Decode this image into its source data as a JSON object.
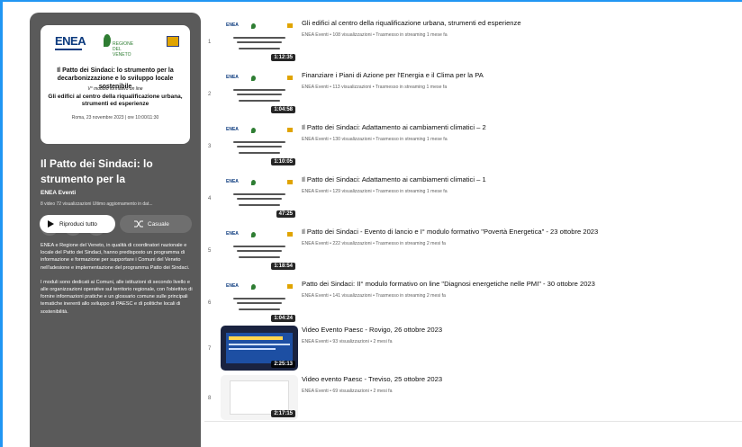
{
  "playlist": {
    "cover": {
      "logo_enea": "ENEA",
      "logo_region": "REGIONE DEL VENETO",
      "title": "Il Patto dei Sindaci: lo strumento per la decarbonizzazione e lo sviluppo locale sostenibile",
      "module": "V° modulo formativo on line",
      "subject": "Gli edifici al centro della riqualificazione urbana, strumenti ed esperienze",
      "date": "Roma, 23 novembre 2023 | ore 10:00/11:30"
    },
    "title": "Il Patto dei Sindaci: lo strumento per la decarbonizzazione e lo...",
    "channel": "ENEA Eventi",
    "meta": "8 video  72 visualizzazioni  Ultimo aggiornamento in dat...",
    "actions": {
      "save_icon": "≡+",
      "share_icon": "↗",
      "more_icon": "⋮",
      "play_all": "Riproduci tutto",
      "shuffle": "Casuale"
    },
    "description": [
      "ENEA e Regione del Veneto, in qualità di coordinatori nazionale e locale del Patto dei Sindaci, hanno predisposto un programma di informazione e formazione per supportare i Comuni del Veneto nell'adesione e implementazione del programma Patto dei Sindaci.",
      "I moduli sono dedicati ai Comuni, alle istituzioni di secondo livello e alle organizzazioni operative sul territorio regionale, con l'obiettivo di fornire informazioni pratiche e un glossario comune sulle principali tematiche inerenti allo sviluppo di PAESC e di politiche locali di sostenibilità."
    ]
  },
  "videos": [
    {
      "index": "1",
      "title": "Gli edifici al centro della riqualificazione urbana, strumenti ed esperienze",
      "meta": "ENEA Eventi • 108 visualizzazioni • Trasmesso in streaming 1 mese fa",
      "duration": "1:12:35",
      "thumb": "slide"
    },
    {
      "index": "2",
      "title": "Finanziare i Piani di Azione per l'Energia e il Clima per la PA",
      "meta": "ENEA Eventi • 113 visualizzazioni • Trasmesso in streaming 1 mese fa",
      "duration": "1:04:58",
      "thumb": "slide"
    },
    {
      "index": "3",
      "title": "Il Patto dei Sindaci: Adattamento ai cambiamenti climatici – 2",
      "meta": "ENEA Eventi • 130 visualizzazioni • Trasmesso in streaming 1 mese fa",
      "duration": "1:10:05",
      "thumb": "slide"
    },
    {
      "index": "4",
      "title": "Il Patto dei Sindaci: Adattamento ai cambiamenti climatici – 1",
      "meta": "ENEA Eventi • 129 visualizzazioni • Trasmesso in streaming 1 mese fa",
      "duration": "47:25",
      "thumb": "slide"
    },
    {
      "index": "5",
      "title": "Il Patto dei Sindaci - Evento di lancio e I° modulo formativo \"Povertà Energetica\" - 23 ottobre 2023",
      "meta": "ENEA Eventi • 222 visualizzazioni • Trasmesso in streaming 2 mesi fa",
      "duration": "1:18:54",
      "thumb": "slide"
    },
    {
      "index": "6",
      "title": "Patto dei Sindaci: II° modulo formativo on line \"Diagnosi energetiche nelle PMI\" - 30 ottobre 2023",
      "meta": "ENEA Eventi • 141 visualizzazioni • Trasmesso in streaming 2 mesi fa",
      "duration": "1:04:24",
      "thumb": "slide"
    },
    {
      "index": "7",
      "title": "Video Evento Paesc - Rovigo, 26 ottobre 2023",
      "meta": "ENEA Eventi • 93 visualizzazioni • 2 mesi fa",
      "duration": "2:25:13",
      "thumb": "dark"
    },
    {
      "index": "8",
      "title": "Video evento Paesc - Treviso, 25 ottobre 2023",
      "meta": "ENEA Eventi • 69 visualizzazioni • 2 mesi fa",
      "duration": "2:17:15",
      "thumb": "light2"
    }
  ],
  "colors": {
    "panel": "#5a5a5a",
    "frame": "#2196f3",
    "duration_bg": "#000000"
  }
}
